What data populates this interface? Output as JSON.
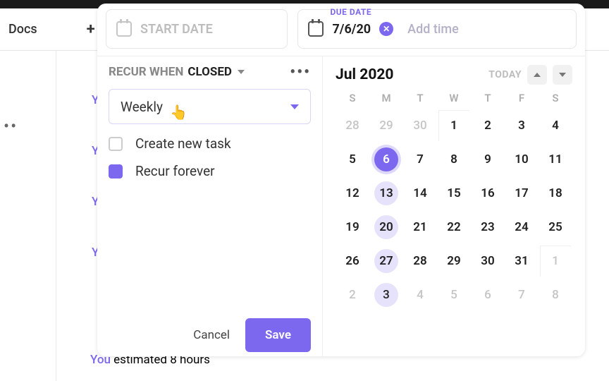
{
  "bg": {
    "docs": "Docs",
    "estimate_prefix": "You",
    "estimate_rest": " estimated 8 hours",
    "purple_lines": [
      "Yo",
      "Yo",
      "Yo",
      "Yo"
    ]
  },
  "dates": {
    "start_placeholder": "START DATE",
    "due_label": "DUE DATE",
    "due_value": "7/6/20",
    "add_time": "Add time"
  },
  "recur": {
    "label": "RECUR WHEN",
    "state": "CLOSED",
    "frequency": "Weekly",
    "create_new_task": "Create new task",
    "recur_forever": "Recur forever"
  },
  "actions": {
    "cancel": "Cancel",
    "save": "Save"
  },
  "calendar": {
    "month": "Jul 2020",
    "today": "TODAY",
    "dow": [
      "S",
      "M",
      "T",
      "W",
      "T",
      "F",
      "S"
    ],
    "weeks": [
      [
        {
          "d": 28,
          "other": true
        },
        {
          "d": 29,
          "other": true
        },
        {
          "d": 30,
          "other": true
        },
        {
          "d": 1,
          "firstbox": true
        },
        {
          "d": 2
        },
        {
          "d": 3
        },
        {
          "d": 4
        }
      ],
      [
        {
          "d": 5
        },
        {
          "d": 6,
          "today": true
        },
        {
          "d": 7
        },
        {
          "d": 8
        },
        {
          "d": 9
        },
        {
          "d": 10
        },
        {
          "d": 11
        }
      ],
      [
        {
          "d": 12
        },
        {
          "d": 13,
          "hl": true
        },
        {
          "d": 14
        },
        {
          "d": 15
        },
        {
          "d": 16
        },
        {
          "d": 17
        },
        {
          "d": 18
        }
      ],
      [
        {
          "d": 19
        },
        {
          "d": 20,
          "hl": true
        },
        {
          "d": 21
        },
        {
          "d": 22
        },
        {
          "d": 23
        },
        {
          "d": 24
        },
        {
          "d": 25
        }
      ],
      [
        {
          "d": 26
        },
        {
          "d": 27,
          "hl": true
        },
        {
          "d": 28
        },
        {
          "d": 29
        },
        {
          "d": 30
        },
        {
          "d": 31
        },
        {
          "d": 1,
          "other": true,
          "firstbox": true
        }
      ],
      [
        {
          "d": 2,
          "other": true
        },
        {
          "d": 3,
          "other": true,
          "hl": true
        },
        {
          "d": 4,
          "other": true
        },
        {
          "d": 5,
          "other": true
        },
        {
          "d": 6,
          "other": true
        },
        {
          "d": 7,
          "other": true
        },
        {
          "d": 8,
          "other": true
        }
      ]
    ]
  }
}
